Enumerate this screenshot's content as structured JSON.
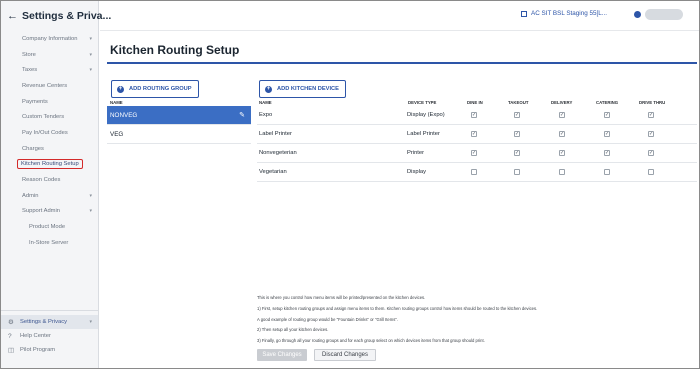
{
  "app": {
    "title": "Settings & Priva...",
    "back_icon": "arrow-left-icon"
  },
  "sidebar": {
    "items": [
      {
        "label": "Company Information",
        "chevron": true
      },
      {
        "label": "Store",
        "chevron": true
      },
      {
        "label": "Taxes",
        "chevron": true
      },
      {
        "label": "Revenue Centers",
        "chevron": false
      },
      {
        "label": "Payments",
        "chevron": false
      },
      {
        "label": "Custom Tenders",
        "chevron": false
      },
      {
        "label": "Pay In/Out Codes",
        "chevron": false
      },
      {
        "label": "Charges",
        "chevron": false
      },
      {
        "label": "Kitchen Routing Setup",
        "chevron": false,
        "active": true
      },
      {
        "label": "Reason Codes",
        "chevron": false
      },
      {
        "label": "Admin",
        "chevron": true
      },
      {
        "label": "Support Admin",
        "chevron": true
      },
      {
        "label": "Product Mode",
        "chevron": false,
        "sub": true
      },
      {
        "label": "In-Store Server",
        "chevron": false,
        "sub": true
      }
    ],
    "footer": [
      {
        "label": "Settings & Privacy",
        "icon": "gear-icon",
        "selected": true
      },
      {
        "label": "Help Center",
        "icon": "help-circle-icon",
        "selected": false
      },
      {
        "label": "Pilot Program",
        "icon": "pilot-program-icon",
        "selected": false
      }
    ]
  },
  "topbar": {
    "store_label": "AC SIT BSL Staging 55[L...",
    "store_icon": "store-icon",
    "user_icon": "user-avatar-icon"
  },
  "page": {
    "title": "Kitchen Routing Setup",
    "add_group_label": "ADD ROUTING GROUP",
    "add_device_label": "ADD KITCHEN DEVICE",
    "groups_header": "NAME",
    "devices_headers": {
      "name": "NAME",
      "type": "DEVICE TYPE",
      "dine_in": "DINE IN",
      "takeout": "TAKEOUT",
      "delivery": "DELIVERY",
      "catering": "CATERING",
      "drive_thru": "DRIVE THRU"
    }
  },
  "groups": [
    {
      "name": "NONVEG",
      "selected": true
    },
    {
      "name": "VEG",
      "selected": false
    }
  ],
  "devices": [
    {
      "name": "Expo",
      "type": "Display (Expo)",
      "dine_in": true,
      "takeout": true,
      "delivery": true,
      "catering": true,
      "drive_thru": true
    },
    {
      "name": "Label Printer",
      "type": "Label Printer",
      "dine_in": true,
      "takeout": true,
      "delivery": true,
      "catering": true,
      "drive_thru": true
    },
    {
      "name": "Nonvegeterian",
      "type": "Printer",
      "dine_in": true,
      "takeout": true,
      "delivery": true,
      "catering": true,
      "drive_thru": true
    },
    {
      "name": "Vegetarian",
      "type": "Display",
      "dine_in": false,
      "takeout": false,
      "delivery": false,
      "catering": false,
      "drive_thru": false
    }
  ],
  "notes": [
    "This is where you control how menu items will be printed/presented on the kitchen devices.",
    "1) First, setup kitchen routing groups and assign menu items to them. Kitchen routing groups control how items should be routed to the kitchen devices.",
    "A good example of routing group would be \"Fountain Drinks\" or \"Grill Items\".",
    "2) Then setup all your kitchen devices.",
    "3) Finally, go through all your routing groups and for each group select on which devices items from that group should print."
  ],
  "actions": {
    "save_label": "Save Changes",
    "discard_label": "Discard Changes"
  },
  "colors": {
    "accent": "#2d55a8",
    "selected_row": "#3b6ec4",
    "highlight_border": "#d32a2a"
  }
}
